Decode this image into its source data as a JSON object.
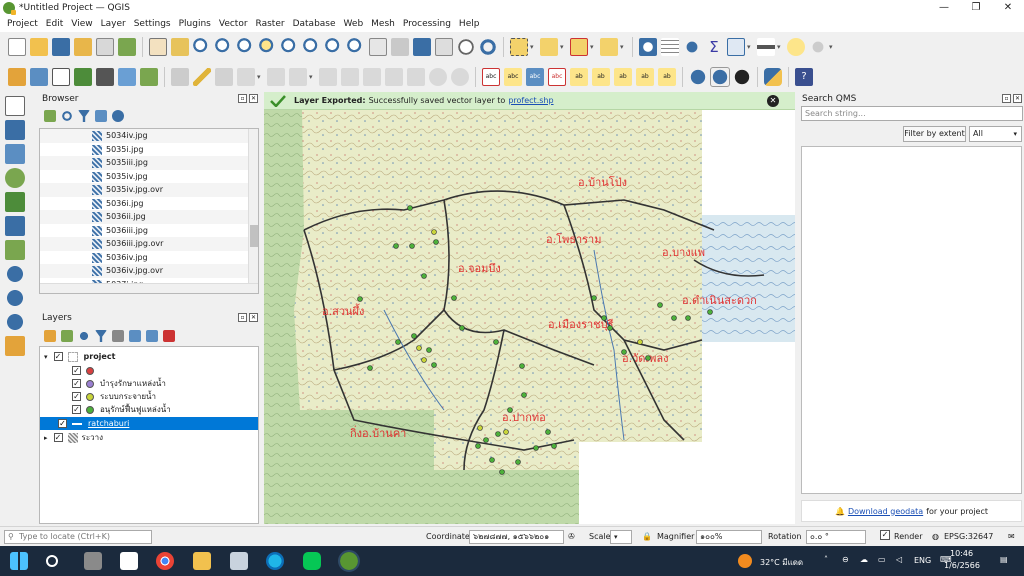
{
  "window": {
    "title": "*Untitled Project — QGIS",
    "minimize": "—",
    "maximize": "❐",
    "close": "✕"
  },
  "menu": [
    "Project",
    "Edit",
    "View",
    "Layer",
    "Settings",
    "Plugins",
    "Vector",
    "Raster",
    "Database",
    "Web",
    "Mesh",
    "Processing",
    "Help"
  ],
  "browser": {
    "title": "Browser",
    "items": [
      "5034iv.jpg",
      "5035i.jpg",
      "5035iii.jpg",
      "5035iv.jpg",
      "5035iv.jpg.ovr",
      "5036i.jpg",
      "5036ii.jpg",
      "5036iii.jpg",
      "5036iii.jpg.ovr",
      "5036iv.jpg",
      "5036iv.jpg.ovr",
      "5037i.jpg"
    ]
  },
  "layers": {
    "title": "Layers",
    "group": "project",
    "sublayers": [
      {
        "label": "",
        "color": "#d94040"
      },
      {
        "label": "บำรุงรักษาแหล่งน้ำ",
        "color": "#9a7fd1"
      },
      {
        "label": "ระบบกระจายน้ำ",
        "color": "#c8d43a"
      },
      {
        "label": "อนุรักษ์ฟื้นฟูแหล่งน้ำ",
        "color": "#4caf3a"
      }
    ],
    "selected": "ratchaburi",
    "last": "ระวาง"
  },
  "message": {
    "title": "Layer Exported:",
    "text": "Successfully saved vector layer to",
    "link": "profect.shp"
  },
  "map_labels": [
    {
      "text": "อ.บ้านโป่ง"
    },
    {
      "text": "อ.โพธาราม"
    },
    {
      "text": "อ.บางแพ"
    },
    {
      "text": "อ.จอมบึง"
    },
    {
      "text": "อ.ดำเนินสะดวก"
    },
    {
      "text": "อ.สวนผึ้ง"
    },
    {
      "text": "อ.เมืองราชบุรี"
    },
    {
      "text": "อ.วัดเพลง"
    },
    {
      "text": "อ.ปากท่อ"
    },
    {
      "text": "กิ่งอ.บ้านคา"
    }
  ],
  "qms": {
    "title": "Search QMS",
    "placeholder": "Search string...",
    "filter": "Filter by extent",
    "select": "All",
    "footer_link": "Download geodata",
    "footer_text": "for your project"
  },
  "status": {
    "locate": "Type to locate (Ctrl+K)",
    "coord_label": "Coordinate",
    "coord": "๖๒๗๘๗๗, ๑๕๖๖๒๐๑",
    "scale_label": "Scale",
    "magnifier_label": "Magnifier",
    "magnifier": "๑๐๐%",
    "rotation_label": "Rotation",
    "rotation": "๐.๐ °",
    "render": "Render",
    "crs": "EPSG:32647"
  },
  "taskbar": {
    "weather": "32°C มีแดด",
    "lang": "ENG",
    "time": "10:46",
    "date": "1/6/2566"
  }
}
